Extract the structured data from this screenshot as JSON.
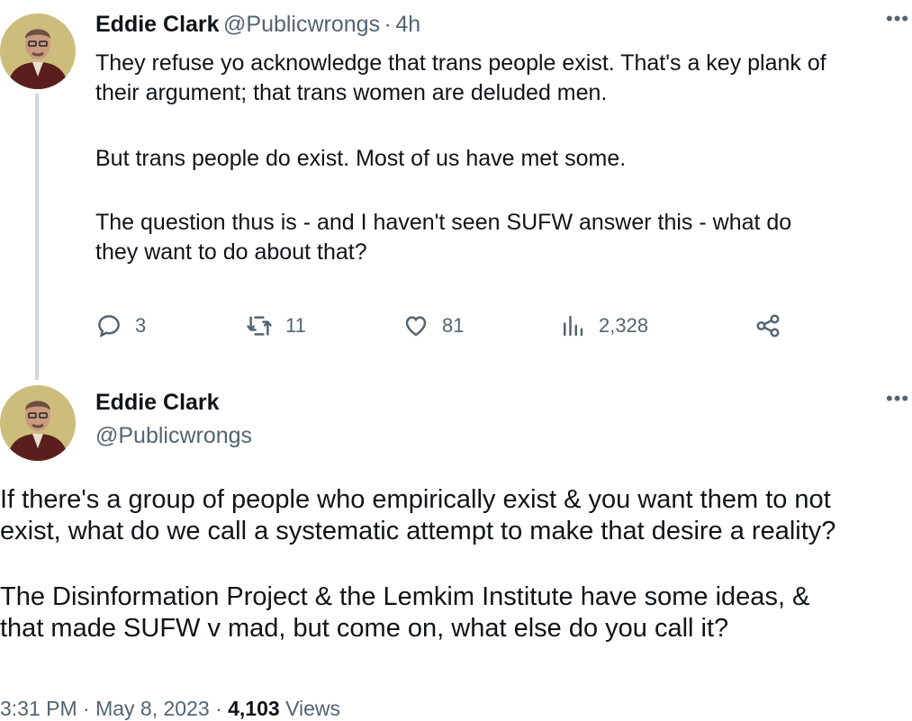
{
  "tweet1": {
    "name": "Eddie Clark",
    "handle": "@Publicwrongs",
    "separator": "·",
    "time": "4h",
    "more_icon": "ellipsis-icon",
    "paragraphs": [
      "They refuse yo acknowledge that trans people exist. That's a key plank of\ntheir argument; that trans women are deluded men.",
      "But trans people do exist. Most of us have met some.",
      "The question thus is - and I haven't seen SUFW answer this - what do\nthey want to do about that?"
    ],
    "actions": {
      "reply_count": "3",
      "retweet_count": "11",
      "like_count": "81",
      "views_count": "2,328"
    }
  },
  "tweet2": {
    "name": "Eddie Clark",
    "handle": "@Publicwrongs",
    "more_icon": "ellipsis-icon",
    "paragraphs": [
      "If there's a group of people who empirically exist & you want them to not\nexist, what do we call a systematic attempt to make that desire a reality?",
      "The Disinformation Project & the Lemkim Institute have some ideas, &\nthat made SUFW v mad, but come on, what else do you call it?"
    ],
    "timestamp": "3:31 PM · May 8, 2023 · ",
    "views_number": "4,103",
    "views_label": " Views"
  },
  "colors": {
    "text": "#0f1419",
    "secondary": "#536471",
    "thread_line": "#cfd9de"
  }
}
